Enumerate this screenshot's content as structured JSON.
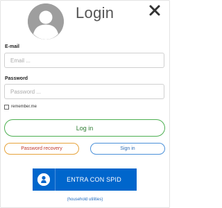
{
  "header": {
    "title": "Login",
    "avatar_icon": "user-avatar-icon",
    "close_icon": "close-icon"
  },
  "form": {
    "email_label": "E-mail",
    "email_placeholder": "Email ...",
    "email_value": "",
    "password_label": "Password",
    "password_placeholder": "Password ...",
    "password_value": "",
    "remember_label": "remember.me",
    "remember_checked": false
  },
  "buttons": {
    "login_label": "Log in",
    "recovery_label": "Password recovery",
    "signin_label": "Sign in"
  },
  "spid": {
    "label": "ENTRA CON SPID",
    "icon": "spid-user-icon",
    "caption": "(household utilities)"
  },
  "colors": {
    "login_border": "#4caf50",
    "recovery_border": "#e6a33b",
    "signin_border": "#4a90d9",
    "spid_background": "#0066cc"
  }
}
